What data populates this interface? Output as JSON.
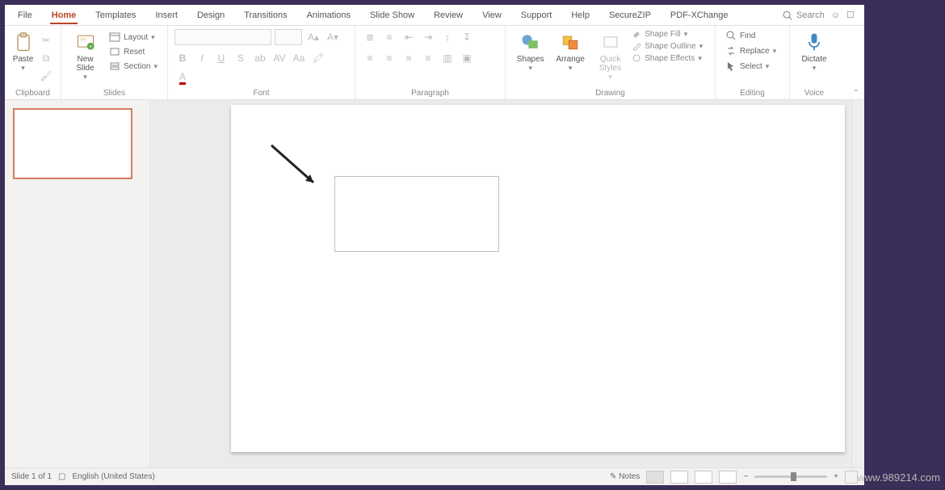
{
  "tabs": {
    "file": "File",
    "home": "Home",
    "templates": "Templates",
    "insert": "Insert",
    "design": "Design",
    "transitions": "Transitions",
    "animations": "Animations",
    "slideshow": "Slide Show",
    "review": "Review",
    "view": "View",
    "support": "Support",
    "help": "Help",
    "securezip": "SecureZIP",
    "pdfxchange": "PDF-XChange"
  },
  "search": {
    "label": "Search"
  },
  "ribbon": {
    "clipboard": {
      "label": "Clipboard",
      "paste": "Paste"
    },
    "slides": {
      "label": "Slides",
      "newslide": "New\nSlide",
      "layout": "Layout",
      "reset": "Reset",
      "section": "Section"
    },
    "font": {
      "label": "Font"
    },
    "paragraph": {
      "label": "Paragraph"
    },
    "drawing": {
      "label": "Drawing",
      "shapes": "Shapes",
      "arrange": "Arrange",
      "quick": "Quick\nStyles",
      "fill": "Shape Fill",
      "outline": "Shape Outline",
      "effects": "Shape Effects"
    },
    "editing": {
      "label": "Editing",
      "find": "Find",
      "replace": "Replace",
      "select": "Select"
    },
    "voice": {
      "label": "Voice",
      "dictate": "Dictate"
    }
  },
  "status": {
    "slide": "Slide 1 of 1",
    "lang": "English (United States)",
    "notes": "Notes"
  },
  "watermark": "www.989214.com"
}
